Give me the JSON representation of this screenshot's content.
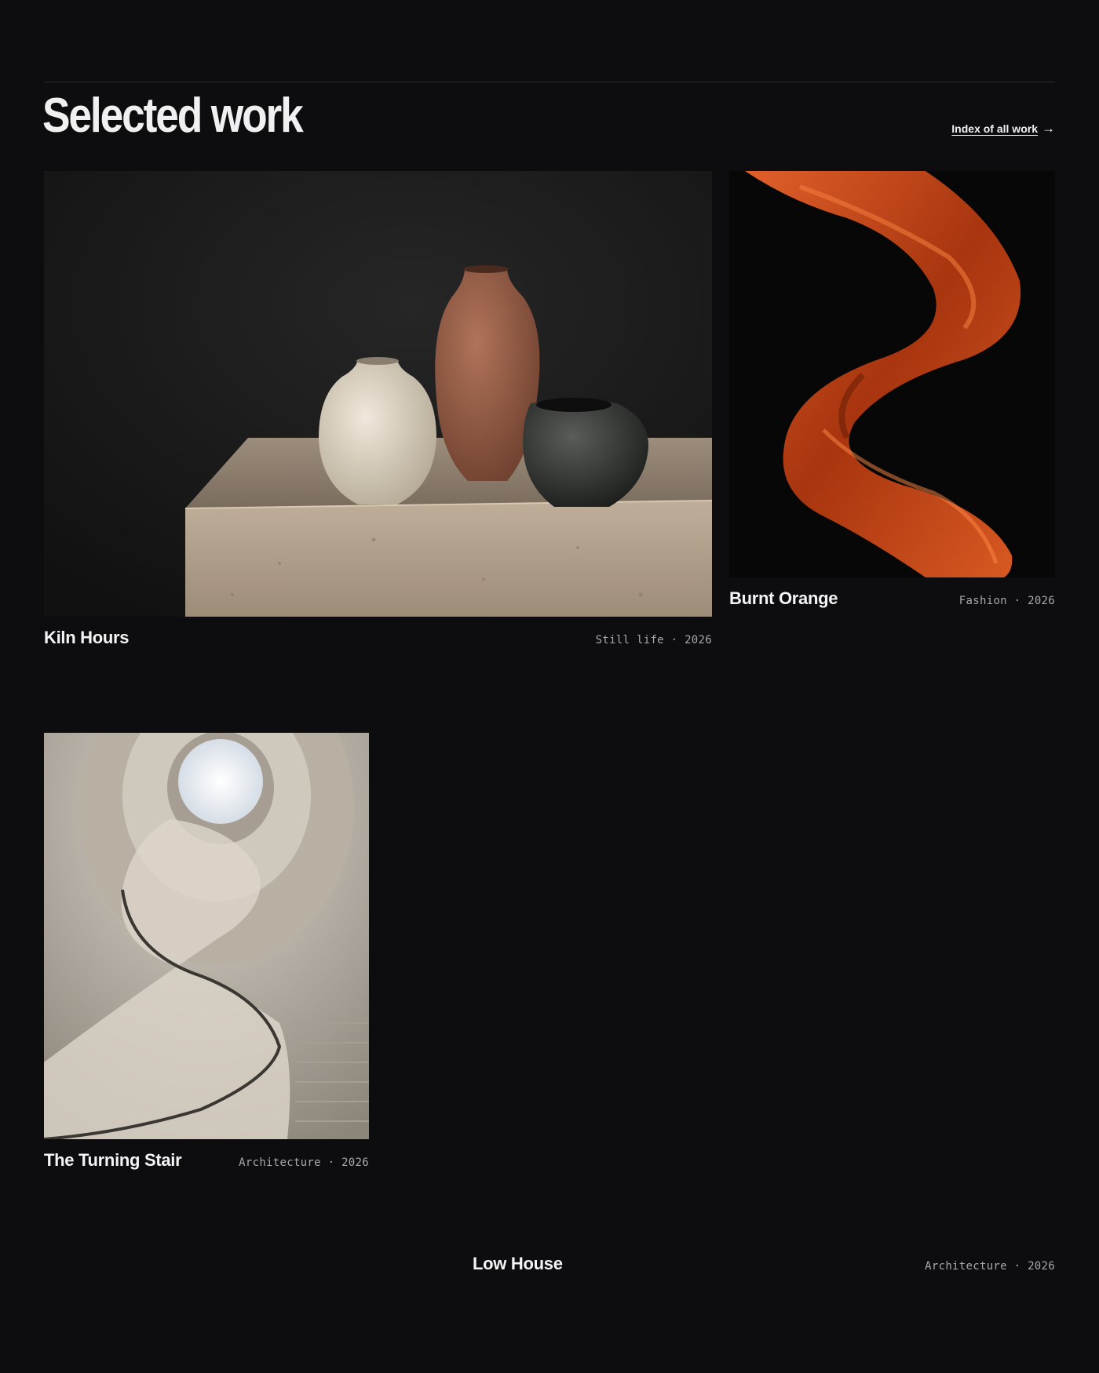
{
  "header": {
    "title": "Selected work",
    "index_link_label": "Index of all work",
    "index_link_arrow": "→"
  },
  "works": [
    {
      "title": "Kiln Hours",
      "meta": "Still life · 2026",
      "image": "ceramic-vases-photo"
    },
    {
      "title": "Burnt Orange",
      "meta": "Fashion · 2026",
      "image": "orange-silk-photo"
    },
    {
      "title": "The Turning Stair",
      "meta": "Architecture · 2026",
      "image": "spiral-staircase-photo"
    },
    {
      "title": "Low House",
      "meta": "Architecture · 2026"
    }
  ]
}
